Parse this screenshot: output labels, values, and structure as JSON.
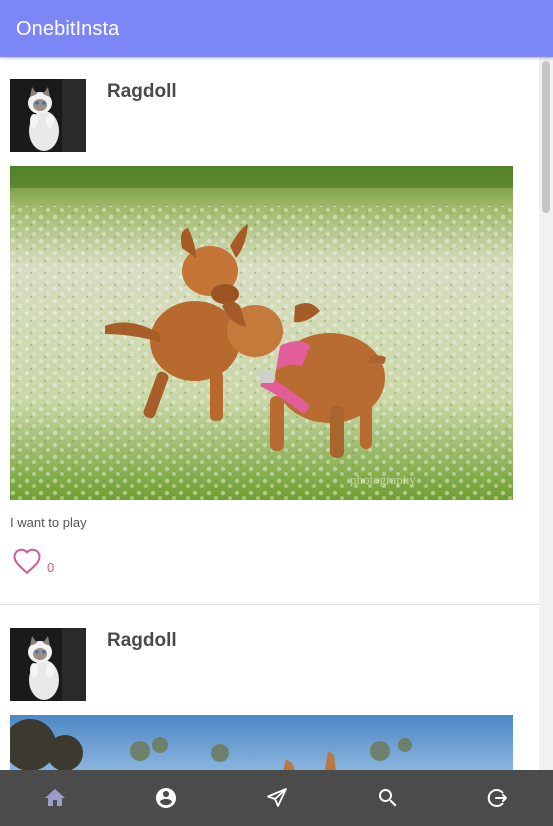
{
  "app": {
    "title": "OnebitInsta"
  },
  "posts": [
    {
      "username": "Ragdoll",
      "caption": "I want to play",
      "likes": "0"
    },
    {
      "username": "Ragdoll"
    }
  ],
  "nav": {
    "items": [
      {
        "icon": "home-icon",
        "active": true
      },
      {
        "icon": "account-circle-icon"
      },
      {
        "icon": "send-icon"
      },
      {
        "icon": "search-icon"
      },
      {
        "icon": "logout-icon"
      }
    ]
  },
  "colors": {
    "header": "#7d86f7",
    "bottom_nav": "#4b4b4b",
    "like": "#d05a92",
    "nav_icon": "#ffffff",
    "nav_icon_active": "#9a9dc6"
  }
}
